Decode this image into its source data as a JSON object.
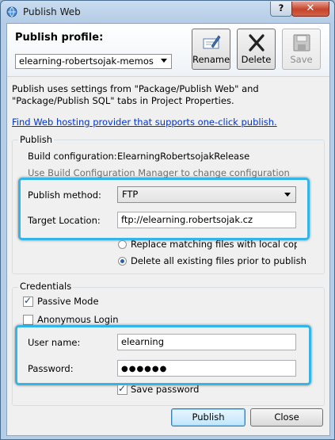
{
  "window": {
    "title": "Publish Web",
    "help_glyph": "?",
    "close_glyph": "✕"
  },
  "profile": {
    "label": "Publish profile:",
    "selected": "elearning-robertsojak-memos",
    "rename_label": "Rename",
    "delete_label": "Delete",
    "save_label": "Save"
  },
  "description": "Publish uses settings from \"Package/Publish Web\" and \"Package/Publish SQL\" tabs in Project Properties.",
  "hosting_link": "Find Web hosting provider that supports one-click publish.",
  "publish": {
    "group_label": "Publish",
    "build_config_label": "Build configuration:",
    "build_config_value": "ElearningRobertsojakRelease",
    "build_config_hint": "Use Build Configuration Manager to change configuration",
    "method_label": "Publish method:",
    "method_value": "FTP",
    "target_label": "Target Location:",
    "target_value": "ftp://elearning.robertsojak.cz",
    "replace_option": "Replace matching files with local copies",
    "delete_option": "Delete all existing files prior to publish"
  },
  "credentials": {
    "group_label": "Credentials",
    "passive_mode": "Passive Mode",
    "anonymous_login": "Anonymous Login",
    "username_label": "User name:",
    "username_value": "elearning",
    "password_label": "Password:",
    "password_value": "●●●●●●",
    "save_password": "Save password"
  },
  "buttons": {
    "publish": "Publish",
    "close": "Close"
  },
  "colors": {
    "highlight": "#34b5e8",
    "link": "#0033cc"
  }
}
